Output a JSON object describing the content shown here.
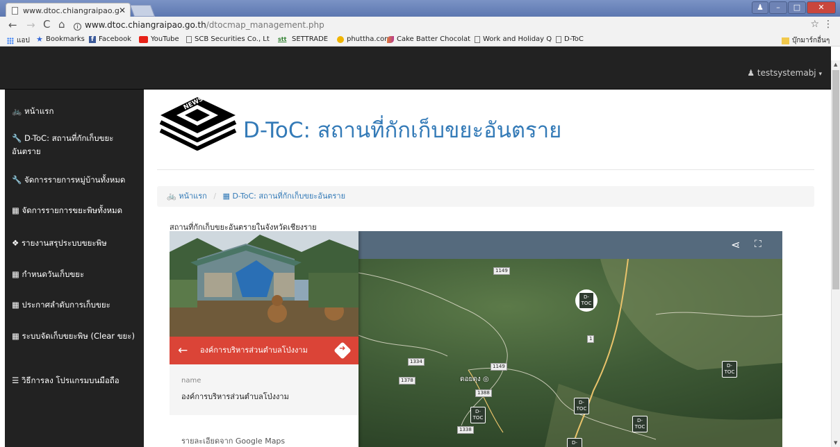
{
  "browser": {
    "tab_title": "www.dtoc.chiangraipao.g",
    "url_host": "www.dtoc.chiangraipao.go.th",
    "url_path": "/dtocmap_management.php",
    "bookmarks": [
      {
        "label": "แอป",
        "icon": "apps-icon"
      },
      {
        "label": "Bookmarks",
        "icon": "star-icon"
      },
      {
        "label": "Facebook",
        "icon": "facebook-icon"
      },
      {
        "label": "YouTube",
        "icon": "youtube-icon"
      },
      {
        "label": "SCB Securities Co., Lt",
        "icon": "page-icon"
      },
      {
        "label": "SETTRADE",
        "icon": "settrade-icon"
      },
      {
        "label": "phuttha.com",
        "icon": "phuttha-icon"
      },
      {
        "label": "Cake Batter Chocolat",
        "icon": "cake-icon"
      },
      {
        "label": "Work and Holiday Q",
        "icon": "page-icon"
      },
      {
        "label": "D-ToC",
        "icon": "page-icon"
      }
    ],
    "other_bookmarks": "บุ๊กมาร์กอื่นๆ"
  },
  "header": {
    "user": "testsystemabj"
  },
  "sidebar": {
    "items": [
      {
        "label": "หน้าแรก",
        "icon": "dashboard-icon"
      },
      {
        "label": "D-ToC: สถานที่กักเก็บขยะอันตราย",
        "icon": "wrench-icon"
      },
      {
        "label": "จัดการรายการหมู่บ้านทั้งหมด",
        "icon": "wrench-icon"
      },
      {
        "label": "จัดการรายการขยะพิษทั้งหมด",
        "icon": "table-icon"
      },
      {
        "label": "รายงานสรุประบบขยะพิษ",
        "icon": "cubes-icon"
      },
      {
        "label": "กำหนดวันเก็บขยะ",
        "icon": "table-icon"
      },
      {
        "label": "ประกาศลำดับการเก็บขยะ",
        "icon": "table-icon"
      },
      {
        "label": "ระบบจัดเก็บขยะพิษ (Clear ขยะ)",
        "icon": "table-icon"
      },
      {
        "label": "วิธีการลง โปรแกรมบนมือถือ",
        "icon": "list-icon"
      }
    ]
  },
  "main": {
    "title": "D-ToC: สถานที่กักเก็บขยะอันตราย",
    "breadcrumb": [
      "หน้าแรก",
      "D-ToC: สถานที่กักเก็บขยะอันตราย"
    ],
    "map_label": "สถานที่กักเก็บขยะอันตรายในจังหวัดเชียงราย"
  },
  "map": {
    "place_title": "องค์การบริหารส่วนตำบลโป่งงาม",
    "field_label": "name",
    "field_value": "องค์การบริหารส่วนตำบลโป่งงาม",
    "details_label": "รายละเอียดจาก Google Maps",
    "town": "ดอยตุง",
    "marker_text": "D-TOC",
    "roads": [
      "1149",
      "1334",
      "1149",
      "1378",
      "1388",
      "1338",
      "1"
    ]
  }
}
